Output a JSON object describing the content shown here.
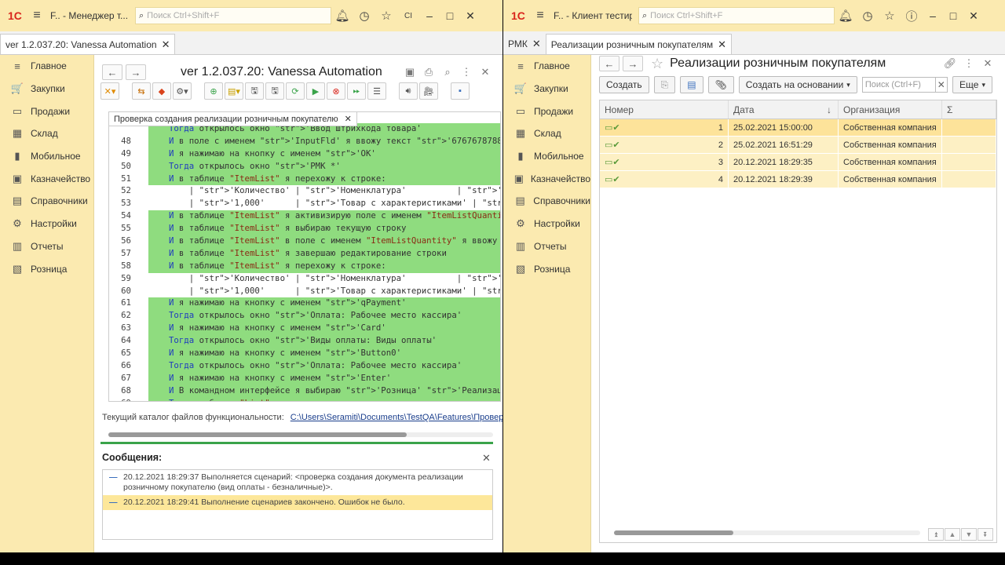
{
  "left_window": {
    "title": {
      "logo": "1С",
      "app": "F.. - Менеджер т...",
      "search_placeholder": "Поиск Ctrl+Shift+F",
      "extra": "СІ"
    },
    "tab": "ver 1.2.037.20: Vanessa Automation",
    "sidebar": [
      {
        "icon": "home-icon",
        "glyph": "≡",
        "label": "Главное"
      },
      {
        "icon": "cart-icon",
        "glyph": "🛒",
        "label": "Закупки"
      },
      {
        "icon": "sales-icon",
        "glyph": "▭",
        "label": "Продажи"
      },
      {
        "icon": "warehouse-icon",
        "glyph": "▦",
        "label": "Склад"
      },
      {
        "icon": "mobile-icon",
        "glyph": "▮",
        "label": "Мобильное"
      },
      {
        "icon": "treasury-icon",
        "glyph": "▣",
        "label": "Казначейство"
      },
      {
        "icon": "catalog-icon",
        "glyph": "▤",
        "label": "Справочники"
      },
      {
        "icon": "settings-icon",
        "glyph": "⚙",
        "label": "Настройки"
      },
      {
        "icon": "reports-icon",
        "glyph": "▥",
        "label": "Отчеты"
      },
      {
        "icon": "retail-icon",
        "glyph": "▧",
        "label": "Розница"
      }
    ],
    "main": {
      "title": "ver 1.2.037.20: Vanessa Automation",
      "editor_tab": "Проверка создания реализации розничным покупателю",
      "code_lines": [
        {
          "n": "",
          "t": "Тогда открылось окно 'Ввод штрихкода товара'",
          "g": true
        },
        {
          "n": "48",
          "t": "И в поле с именем 'InputFld' я ввожу текст '67676787889899'",
          "g": true
        },
        {
          "n": "49",
          "t": "И я нажимаю на кнопку с именем 'OK'",
          "g": true
        },
        {
          "n": "50",
          "t": "Тогда открылось окно 'РМК *'",
          "g": true
        },
        {
          "n": "51",
          "t": "И в таблице \"ItemList\" я перехожу к строке:",
          "g": true
        },
        {
          "n": "52",
          "t": "    | 'Количество' | 'Номенклатура'          | 'Общая сумма' |",
          "g": false
        },
        {
          "n": "53",
          "t": "    | '1,000'      | 'Товар с характеристиками' | '210,00'  |",
          "g": false
        },
        {
          "n": "54",
          "t": "И в таблице \"ItemList\" я активизирую поле с именем \"ItemListQuantity\"",
          "g": true
        },
        {
          "n": "55",
          "t": "И в таблице \"ItemList\" я выбираю текущую строку",
          "g": true
        },
        {
          "n": "56",
          "t": "И в таблице \"ItemList\" в поле с именем \"ItemListQuantity\" я ввожу",
          "g": true
        },
        {
          "n": "57",
          "t": "И в таблице \"ItemList\" я завершаю редактирование строки",
          "g": true
        },
        {
          "n": "58",
          "t": "И в таблице \"ItemList\" я перехожу к строке:",
          "g": true
        },
        {
          "n": "59",
          "t": "    | 'Количество' | 'Номенклатура'          | 'Общая сумма' |",
          "g": false
        },
        {
          "n": "60",
          "t": "    | '1,000'      | 'Товар с характеристиками' | '250,00'  |",
          "g": false
        },
        {
          "n": "61",
          "t": "И я нажимаю на кнопку с именем 'qPayment'",
          "g": true
        },
        {
          "n": "62",
          "t": "Тогда открылось окно 'Оплата: Рабочее место кассира'",
          "g": true
        },
        {
          "n": "63",
          "t": "И я нажимаю на кнопку с именем 'Card'",
          "g": true
        },
        {
          "n": "64",
          "t": "Тогда открылось окно 'Виды оплаты: Виды оплаты'",
          "g": true
        },
        {
          "n": "65",
          "t": "И я нажимаю на кнопку с именем 'Button0'",
          "g": true
        },
        {
          "n": "66",
          "t": "Тогда открылось окно 'Оплата: Рабочее место кассира'",
          "g": true
        },
        {
          "n": "67",
          "t": "И я нажимаю на кнопку с именем 'Enter'",
          "g": true
        },
        {
          "n": "68",
          "t": "И В командном интерфейсе я выбираю 'Розница' 'Реализации розничным'",
          "g": true
        },
        {
          "n": "69",
          "t": "Тогда таблица \"List\" содержит строки:",
          "g": true
        }
      ],
      "path_label": "Текущий каталог файлов функциональности:",
      "path_value": "C:\\Users\\Seramiti\\Documents\\TestQA\\Features\\Проверка создания",
      "messages_title": "Сообщения:",
      "messages": [
        {
          "text": "20.12.2021 18:29:37 Выполняется сценарий: <проверка создания документа реализации розничному покупателю (вид оплаты - безналичные)>.",
          "hl": false
        },
        {
          "text": "20.12.2021 18:29:41 Выполнение сценариев закончено. Ошибок не было.",
          "hl": true
        }
      ]
    }
  },
  "right_window": {
    "title": {
      "logo": "1С",
      "app": "F.. - Клиент тестир...",
      "search_placeholder": "Поиск Ctrl+Shift+F"
    },
    "tabs": [
      "РМК",
      "Реализации розничным покупателям"
    ],
    "sidebar": [
      {
        "icon": "home-icon",
        "glyph": "≡",
        "label": "Главное"
      },
      {
        "icon": "cart-icon",
        "glyph": "🛒",
        "label": "Закупки"
      },
      {
        "icon": "sales-icon",
        "glyph": "▭",
        "label": "Продажи"
      },
      {
        "icon": "warehouse-icon",
        "glyph": "▦",
        "label": "Склад"
      },
      {
        "icon": "mobile-icon",
        "glyph": "▮",
        "label": "Мобильное"
      },
      {
        "icon": "treasury-icon",
        "glyph": "▣",
        "label": "Казначейство"
      },
      {
        "icon": "catalog-icon",
        "glyph": "▤",
        "label": "Справочники"
      },
      {
        "icon": "settings-icon",
        "glyph": "⚙",
        "label": "Настройки"
      },
      {
        "icon": "reports-icon",
        "glyph": "▥",
        "label": "Отчеты"
      },
      {
        "icon": "retail-icon",
        "glyph": "▧",
        "label": "Розница"
      }
    ],
    "main": {
      "title": "Реализации розничным покупателям",
      "create_label": "Создать",
      "create_based_label": "Создать на основании",
      "search_placeholder": "Поиск (Ctrl+F)",
      "more_label": "Еще",
      "columns": {
        "num": "Номер",
        "date": "Дата",
        "org": "Организация",
        "sum": "Σ"
      },
      "rows": [
        {
          "num": "1",
          "date": "25.02.2021 15:00:00",
          "org": "Собственная компания"
        },
        {
          "num": "2",
          "date": "25.02.2021 16:51:29",
          "org": "Собственная компания"
        },
        {
          "num": "3",
          "date": "20.12.2021 18:29:35",
          "org": "Собственная компания"
        },
        {
          "num": "4",
          "date": "20.12.2021 18:29:39",
          "org": "Собственная компания"
        }
      ]
    }
  }
}
